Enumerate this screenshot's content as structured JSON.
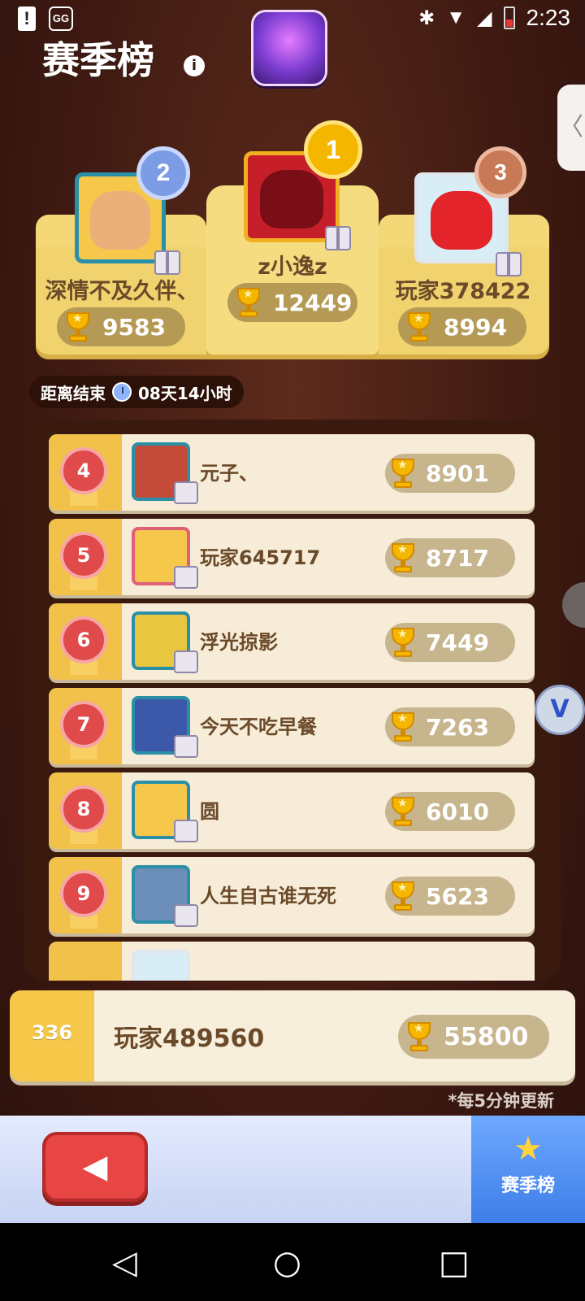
{
  "status_bar": {
    "time": "2:23",
    "left_icons": [
      "alert-icon",
      "gg-icon"
    ],
    "right_icons": [
      "bluetooth-icon",
      "wifi-icon",
      "signal-icon",
      "battery-icon"
    ]
  },
  "header": {
    "title": "赛季榜",
    "info_glyph": "i"
  },
  "side_tab": {
    "glyph": "〈"
  },
  "podium": {
    "first": {
      "rank": "1",
      "name": "z小逸z",
      "score": "12449"
    },
    "second": {
      "rank": "2",
      "name": "深情不及久伴、",
      "score": "9583"
    },
    "third": {
      "rank": "3",
      "name": "玩家378422",
      "score": "8994"
    }
  },
  "countdown": {
    "label": "距离结束",
    "value": "08天14小时"
  },
  "rows": [
    {
      "rank": "4",
      "name": "元子、",
      "score": "8901"
    },
    {
      "rank": "5",
      "name": "玩家645717",
      "score": "8717"
    },
    {
      "rank": "6",
      "name": "浮光掠影",
      "score": "7449"
    },
    {
      "rank": "7",
      "name": "今天不吃早餐",
      "score": "7263"
    },
    {
      "rank": "8",
      "name": "圆",
      "score": "6010"
    },
    {
      "rank": "9",
      "name": "人生自古谁无死",
      "score": "5623"
    }
  ],
  "my_rank": {
    "rank": "336",
    "name": "玩家489560",
    "score": "55800"
  },
  "update_note": "*每5分钟更新",
  "bottom": {
    "back_glyph": "◀",
    "tab_icon_glyph": "★",
    "tab_label": "赛季榜"
  },
  "floating": {
    "v_glyph": "V"
  },
  "nav": {
    "back": "◁",
    "home": "○",
    "recents": "□"
  },
  "colors": {
    "accent_gold": "#f2c14a",
    "rank_red": "#e04a4a",
    "brand_blue": "#3d7ee8"
  }
}
